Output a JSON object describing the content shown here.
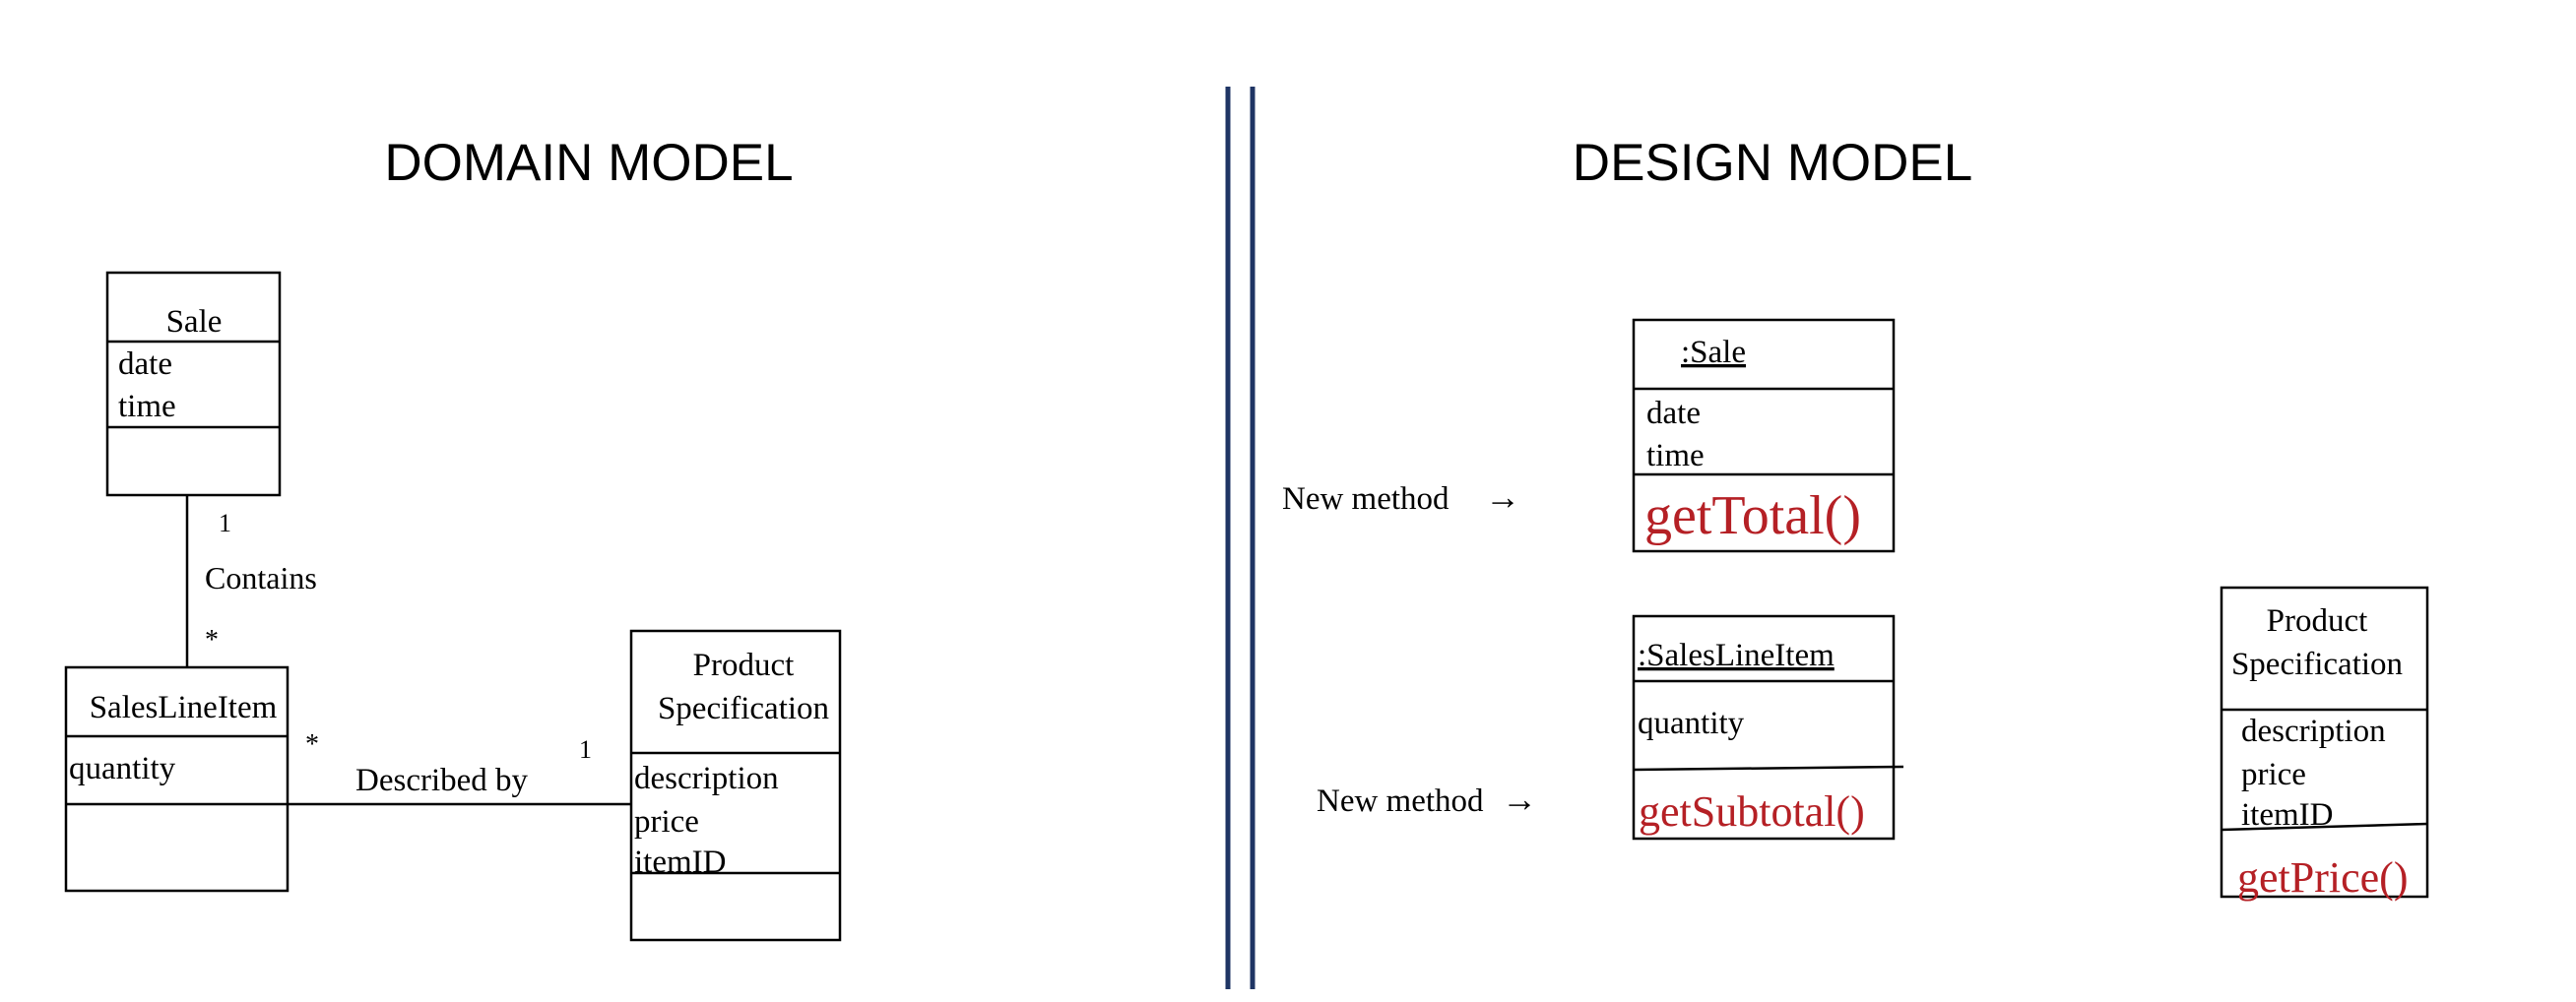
{
  "domain_model": {
    "title": "DOMAIN MODEL",
    "sale": {
      "name": "Sale",
      "attrs": [
        "date",
        "time"
      ]
    },
    "sales_line_item": {
      "name": "SalesLineItem",
      "attrs": [
        "quantity"
      ]
    },
    "product_spec": {
      "name_line1": "Product",
      "name_line2": "Specification",
      "attrs": [
        "description",
        "price",
        "itemID"
      ]
    },
    "contains": {
      "label": "Contains",
      "mult_top": "1",
      "mult_bottom": "*"
    },
    "described_by": {
      "label": "Described by",
      "mult_left": "*",
      "mult_right": "1"
    }
  },
  "design_model": {
    "title": "DESIGN MODEL",
    "sale": {
      "name": ":Sale",
      "attrs": [
        "date",
        "time"
      ],
      "method": "getTotal()"
    },
    "sales_line_item": {
      "name": ":SalesLineItem",
      "attrs": [
        "quantity"
      ],
      "method": "getSubtotal()"
    },
    "product_spec": {
      "name_line1": "Product",
      "name_line2": "Specification",
      "attrs": [
        "description",
        "price",
        "itemID"
      ],
      "method": "getPrice()"
    },
    "note1": {
      "text": "New method",
      "arrow": "→"
    },
    "note2": {
      "text": "New method",
      "arrow": "→"
    }
  },
  "colors": {
    "method": "#b52025",
    "divider": "#1f3564"
  }
}
